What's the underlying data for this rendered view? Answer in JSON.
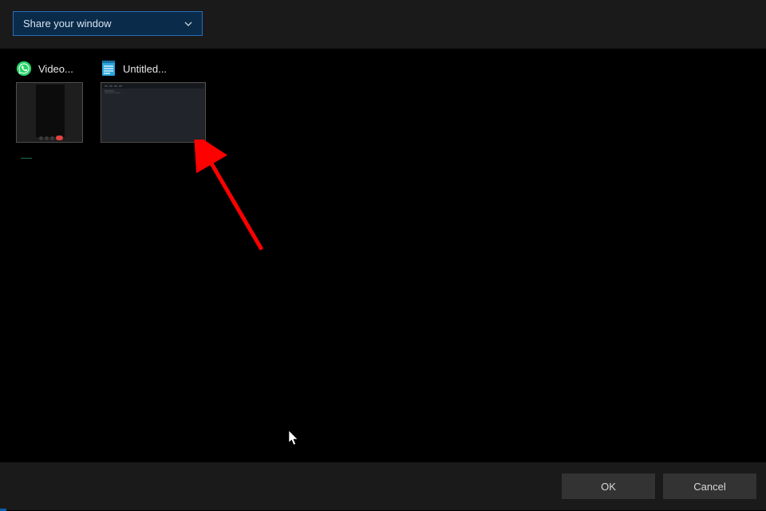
{
  "dropdown": {
    "label": "Share your window"
  },
  "windows": [
    {
      "label": "Video...",
      "icon": "whatsapp"
    },
    {
      "label": "Untitled...",
      "icon": "notepad"
    }
  ],
  "footer": {
    "ok_label": "OK",
    "cancel_label": "Cancel"
  },
  "colors": {
    "dropdown_bg": "#0a2b4a",
    "dropdown_border": "#2a6db8",
    "header_bg": "#1a1a1a",
    "arrow": "#ff0000",
    "whatsapp": "#25d366",
    "notepad": "#2ba6df"
  }
}
